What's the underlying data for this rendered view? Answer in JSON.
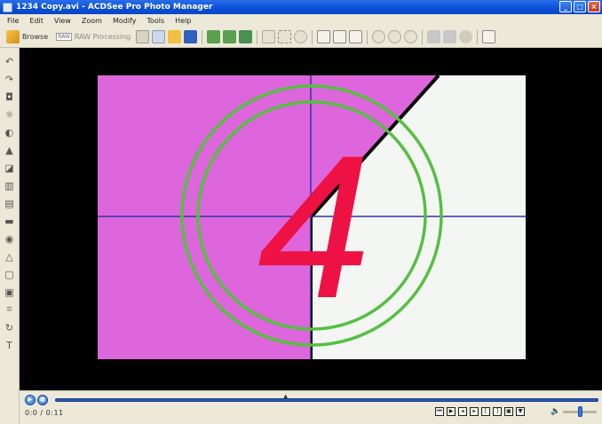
{
  "window": {
    "title": "1234 Copy.avi - ACDSee Pro Photo Manager",
    "minimize_glyph": "_",
    "maximize_glyph": "□",
    "close_glyph": "×"
  },
  "menu": [
    "File",
    "Edit",
    "View",
    "Zoom",
    "Modify",
    "Tools",
    "Help"
  ],
  "toolbar": {
    "browse_label": "Browse",
    "raw_tag": "RAW",
    "raw_label": "RAW Processing"
  },
  "video_frame": {
    "countdown_digit": "4",
    "colors": {
      "left_panel": "#dd66dd",
      "right_panel": "#f4f6f4",
      "ring": "#55c040",
      "digit": "#ee1144",
      "crosshair": "#3333aa"
    }
  },
  "playback": {
    "timecode": "0:0 / 0:11",
    "collapse_glyph": "▲",
    "play_glyph": "▶",
    "stop_glyph": "■",
    "volume_glyph": "🔈",
    "volume_level": 0.5
  }
}
